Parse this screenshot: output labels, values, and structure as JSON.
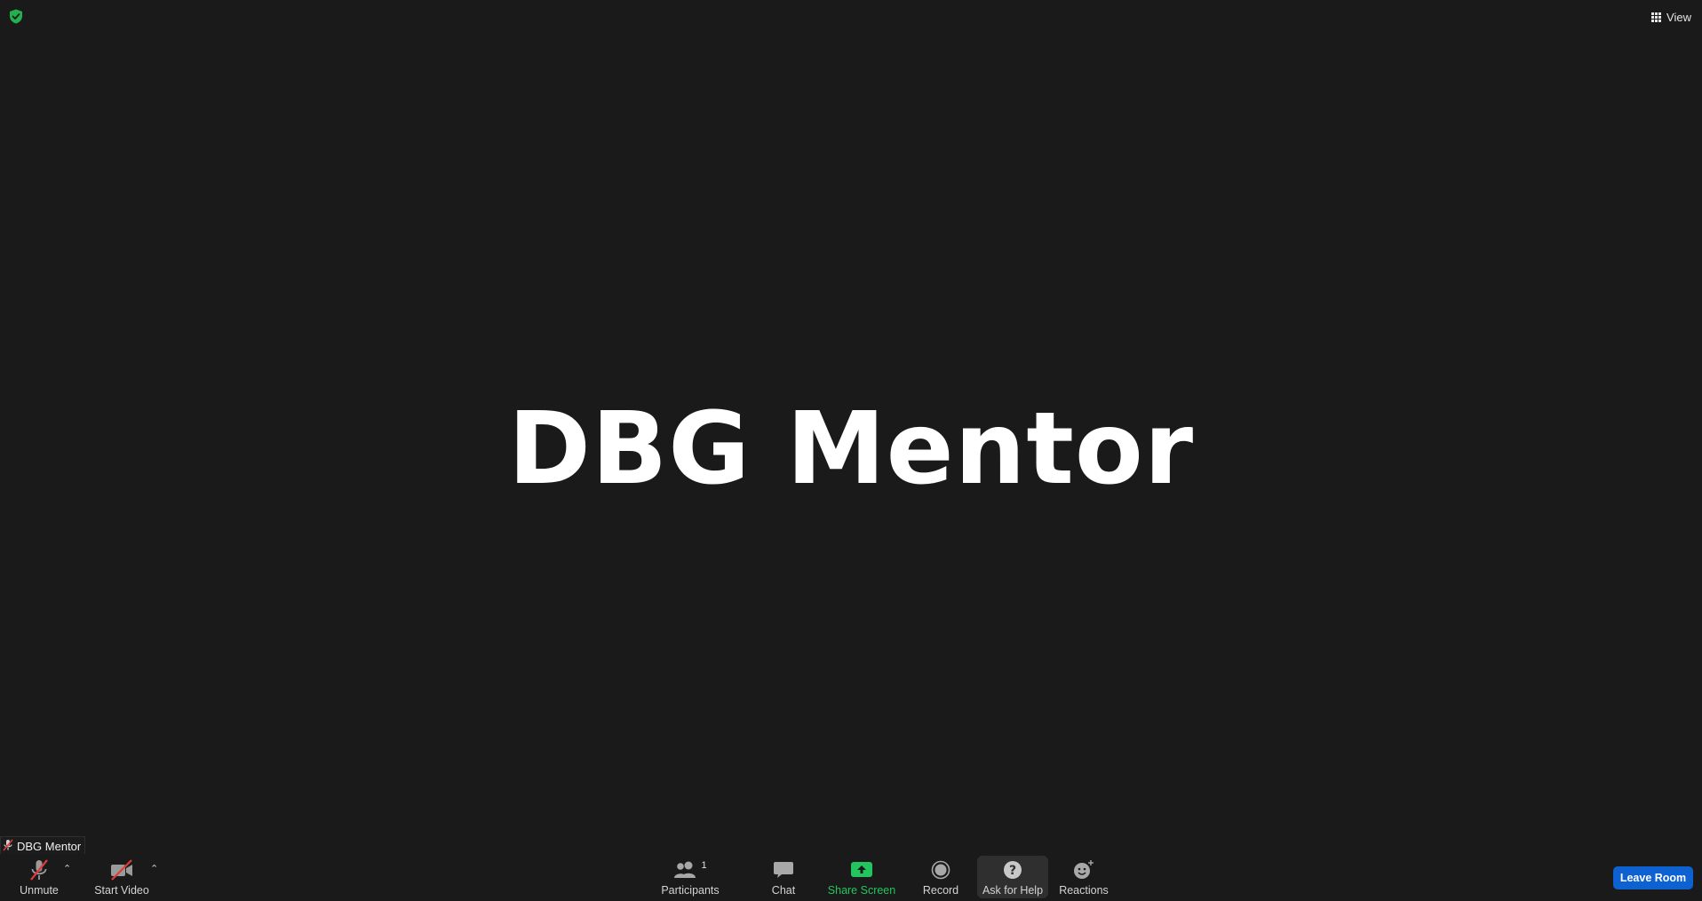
{
  "meeting": {
    "participant_display_name": "DBG Mentor"
  },
  "top_bar": {
    "view_label": "View",
    "security_icon": "shield-check-icon"
  },
  "name_tag": {
    "name": "DBG Mentor",
    "muted_icon": "mic-muted-icon"
  },
  "toolbar": {
    "unmute_label": "Unmute",
    "start_video_label": "Start Video",
    "participants_label": "Participants",
    "participants_count": "1",
    "chat_label": "Chat",
    "share_screen_label": "Share Screen",
    "record_label": "Record",
    "ask_help_label": "Ask for Help",
    "reactions_label": "Reactions",
    "leave_label": "Leave Room"
  },
  "colors": {
    "background": "#1a1a1a",
    "share_green": "#22c55e",
    "leave_blue": "#0e61d1",
    "muted_red": "#e03a3a"
  }
}
